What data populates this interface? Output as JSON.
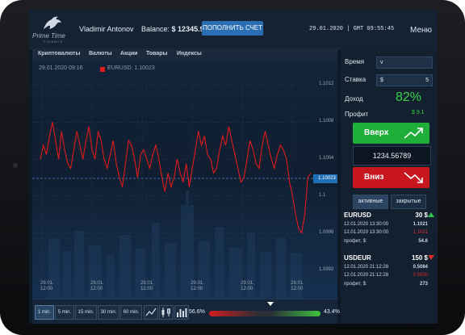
{
  "header": {
    "logo_name": "Prime Time",
    "logo_tagline": "FINANCE",
    "user_name": "Vladimir Antonov",
    "balance_label": "Balance:",
    "balance_value": "$ 12345.90",
    "deposit_button": "ПОПОЛНИТЬ СЧЕТ",
    "datetime": "29.01.2020 | GMT 09:55:45",
    "menu": "Меню"
  },
  "categories": [
    "Криптовалюты",
    "Валюты",
    "Акции",
    "Товары",
    "Индексы"
  ],
  "chart": {
    "timestamp": "29.01.2020 09:16",
    "instrument_label": "EURUSD: 1.10023",
    "current_price": "1.10023",
    "line_color": "#e01b1b",
    "accent_color": "#1e6fb5"
  },
  "chart_data": {
    "type": "line",
    "ylim": [
      1.0991,
      1.1013
    ],
    "yticks": [
      "1.1012",
      "1.1008",
      "1.1004",
      "1.1",
      "1.0996",
      "1.0992"
    ],
    "xticks": [
      "29.01.\n12:00",
      "29.01.\n12:00",
      "29.01.\n12:00",
      "29.01.\n12:00",
      "29.01.\n12:00",
      "29.01.\n12:00"
    ],
    "series": [
      {
        "values": [
          1.1004,
          1.10055,
          1.10045,
          1.10065,
          1.1008,
          1.1006,
          1.1004,
          1.1007,
          1.1005,
          1.10035,
          1.1003,
          1.1005,
          1.1007,
          1.10055,
          1.1004,
          1.1006,
          1.10075,
          1.1005,
          1.1004,
          1.1007,
          1.1006,
          1.1004,
          1.1003,
          1.10045,
          1.1006,
          1.10035,
          1.1002,
          1.1001,
          1.10035,
          1.1006,
          1.10055,
          1.1004,
          1.1002,
          1.10045,
          1.1005,
          1.1004,
          1.1003,
          1.10045,
          1.10055,
          1.1004,
          1.1002,
          1.10005,
          1.10025,
          1.1001,
          1.1002,
          1.1004,
          1.10025,
          1.10015,
          1.10035,
          1.1001,
          1.1003,
          1.1005,
          1.1007,
          1.10055,
          1.10065,
          1.10045,
          1.1004,
          1.10025,
          1.1003,
          1.1005,
          1.10065,
          1.10055,
          1.10075,
          1.1006,
          1.10045,
          1.1003,
          1.10015,
          1.1002,
          1.1004,
          1.1006,
          1.1005,
          1.10035,
          1.1003,
          1.10055,
          1.1007,
          1.10055,
          1.1004,
          1.1003,
          1.10045,
          1.10055,
          1.1005,
          1.1004,
          1.10015,
          1.1,
          1.0998,
          1.09965,
          1.0996,
          1.0998,
          1.1002,
          1.10025
        ]
      }
    ]
  },
  "toolbar": {
    "timeframes": [
      "1 min.",
      "5 min.",
      "15 min.",
      "30 min.",
      "60 min."
    ],
    "active_timeframe": "1 min.",
    "icons": [
      "line-chart-icon",
      "candlestick-chart-icon",
      "bar-chart-icon"
    ],
    "sell_percent": "56.6%",
    "buy_percent": "43.4%",
    "sentiment_buy_fraction": 0.434
  },
  "trade": {
    "time_label": "Время",
    "time_value": "v",
    "stake_label": "Ставка",
    "stake_currency": "$",
    "stake_value": "5",
    "income_label": "Доход",
    "income_value": "82%",
    "profit_label": "Профит",
    "profit_value": "$ 9.1",
    "up_button": "Вверх",
    "down_button": "Вниз",
    "current_price": "1234.56789",
    "tab_active": "активные",
    "tab_closed": "закрытые",
    "up_color": "#1fae3a",
    "down_color": "#c8161f"
  },
  "deals": [
    {
      "pair": "EURUSD",
      "amount": "30 $",
      "direction": "up",
      "open_time": "12.01.2020 13:30:00",
      "open_price": "1.1021",
      "close_time": "12.01.2020 13:30:00",
      "close_price": "1.1021",
      "profit_label": "профит, $:",
      "profit_value": "54.6"
    },
    {
      "pair": "USDEUR",
      "amount": "150 $",
      "direction": "down",
      "open_time": "12.01.2020 21:12:28",
      "open_price": "0.5084",
      "close_time": "12.01.2020 21:12:28",
      "close_price": "0.5000",
      "profit_label": "профит, $:",
      "profit_value": "273"
    }
  ]
}
